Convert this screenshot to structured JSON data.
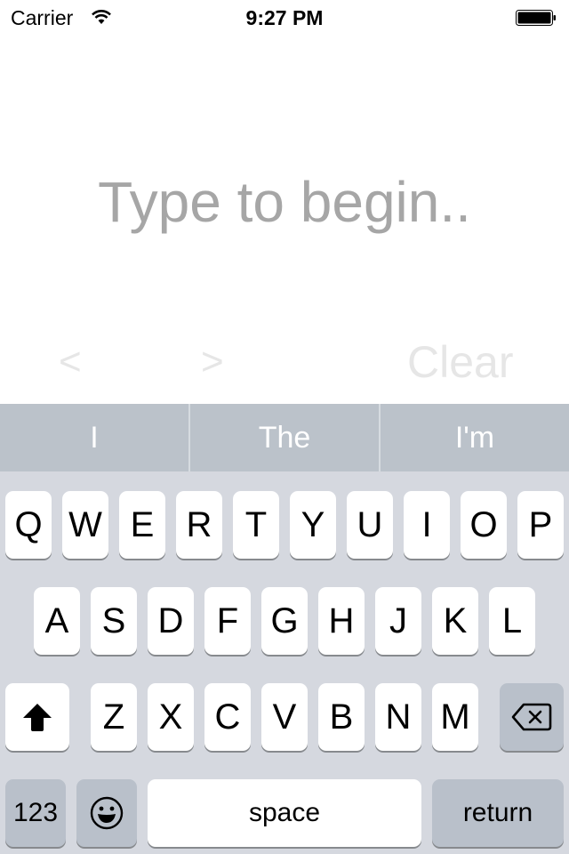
{
  "status_bar": {
    "carrier": "Carrier",
    "time": "9:27 PM",
    "wifi_icon": "wifi-icon",
    "battery_icon": "battery-full-icon"
  },
  "editor": {
    "placeholder": "Type to begin..",
    "prev_label": "<",
    "next_label": ">",
    "clear_label": "Clear"
  },
  "suggestions": [
    "I",
    "The",
    "I'm"
  ],
  "keyboard": {
    "row1": [
      "Q",
      "W",
      "E",
      "R",
      "T",
      "Y",
      "U",
      "I",
      "O",
      "P"
    ],
    "row2": [
      "A",
      "S",
      "D",
      "F",
      "G",
      "H",
      "J",
      "K",
      "L"
    ],
    "row3": [
      "Z",
      "X",
      "C",
      "V",
      "B",
      "N",
      "M"
    ],
    "shift_icon": "shift-arrow-icon",
    "delete_icon": "backspace-icon",
    "numbers_label": "123",
    "emoji_icon": "emoji-icon",
    "space_label": "space",
    "return_label": "return"
  }
}
